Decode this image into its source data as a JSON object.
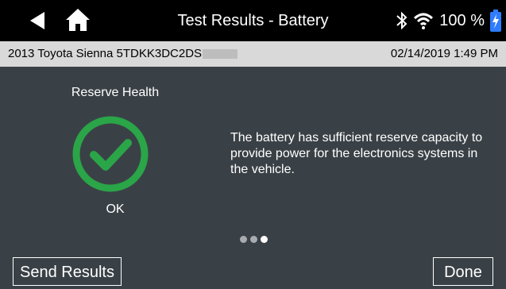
{
  "header": {
    "title": "Test Results - Battery",
    "battery_percent": "100 %"
  },
  "vehicle": {
    "description": "2013 Toyota Sienna 5TDKK3DC2DS",
    "datetime": "02/14/2019 1:49 PM"
  },
  "result": {
    "title": "Reserve Health",
    "status": "OK",
    "description": "The battery has sufficient reserve capacity to provide power for the electronics systems in the vehicle.",
    "icon": "check-circle-icon",
    "icon_color": "#2aa548"
  },
  "pager": {
    "total": 3,
    "active_index": 3
  },
  "buttons": {
    "send": "Send Results",
    "done": "Done"
  },
  "colors": {
    "topbar": "#000000",
    "infobar": "#d9d9d9",
    "background": "#3a4146",
    "battery": "#2f7dff"
  }
}
